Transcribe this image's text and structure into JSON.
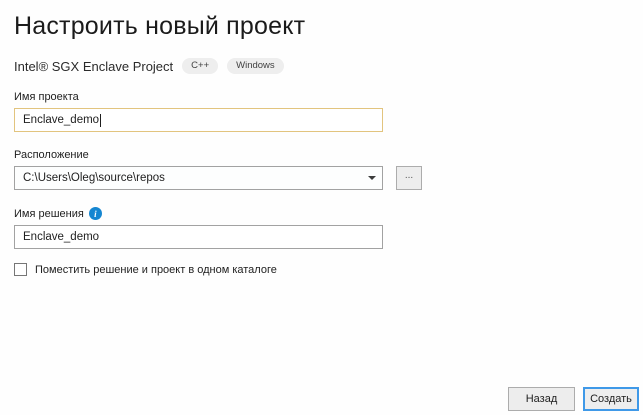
{
  "page": {
    "title": "Настроить новый проект",
    "subtitle": "Intel® SGX Enclave Project",
    "tags": [
      "C++",
      "Windows"
    ]
  },
  "form": {
    "project_name": {
      "label": "Имя проекта",
      "value": "Enclave_demo"
    },
    "location": {
      "label": "Расположение",
      "value": "C:\\Users\\Oleg\\source\\repos",
      "browse_label": "..."
    },
    "solution_name": {
      "label": "Имя решения",
      "value": "Enclave_demo"
    },
    "same_dir_checkbox": {
      "label": "Поместить решение и проект в одном каталоге",
      "checked": false
    }
  },
  "footer": {
    "back_label": "Назад",
    "create_label": "Создать"
  },
  "colors": {
    "accent_blue": "#3f99e8",
    "focused_input_border": "#e2c47e",
    "input_border": "#a2a2a2",
    "info_icon_blue": "#1586d1"
  }
}
